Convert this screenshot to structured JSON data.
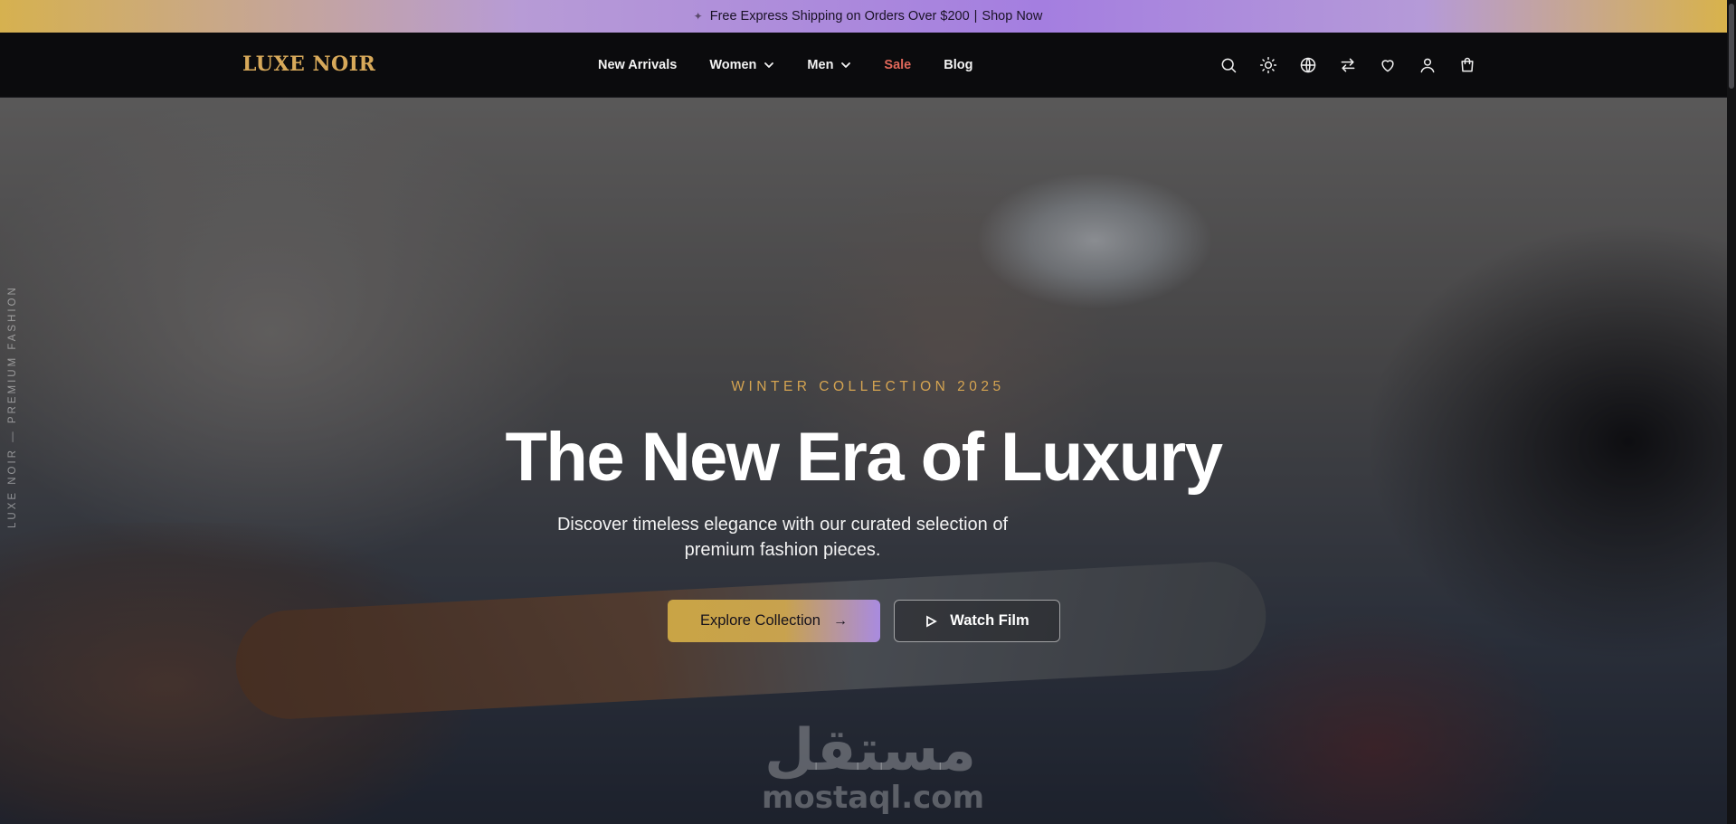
{
  "announcement": {
    "icon": "sparkle-icon",
    "text": "Free Express Shipping on Orders Over $200",
    "separator": "|",
    "link": "Shop Now",
    "colors": {
      "gradient_start": "#d6b14f",
      "gradient_mid": "#a47ee0",
      "text": "#1a1226"
    }
  },
  "header": {
    "logo": "LUXE NOIR",
    "logo_color": "#d7a95a",
    "nav": [
      {
        "label": "New Arrivals",
        "dropdown": false
      },
      {
        "label": "Women",
        "dropdown": true
      },
      {
        "label": "Men",
        "dropdown": true
      },
      {
        "label": "Sale",
        "dropdown": false,
        "accent": "#e0685a"
      },
      {
        "label": "Blog",
        "dropdown": false
      }
    ],
    "actions": [
      "search-icon",
      "theme-sun-icon",
      "language-globe-icon",
      "compare-arrows-icon",
      "wishlist-heart-icon",
      "account-user-icon",
      "cart-bag-icon"
    ]
  },
  "hero": {
    "side_text": "LUXE NOIR — PREMIUM FASHION",
    "eyebrow": "WINTER COLLECTION 2025",
    "headline": "The New Era of Luxury",
    "subtitle": "Discover timeless elegance with our curated selection of premium fashion pieces.",
    "primary_button": {
      "label": "Explore Collection",
      "icon": "arrow-right-icon"
    },
    "secondary_button": {
      "label": "Watch Film",
      "icon": "play-icon"
    },
    "accent_color": "#d5a451"
  },
  "watermark": {
    "arabic": "مستقل",
    "latin": "mostaql.com"
  }
}
